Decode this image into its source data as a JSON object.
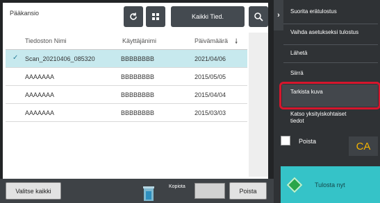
{
  "browser": {
    "folder_title": "Pääkansio",
    "filter_label": "Kaikki Tied.",
    "columns": {
      "file_name": "Tiedoston Nimi",
      "user_name": "Käyttäjänimi",
      "date": "Päivämäärä"
    },
    "rows": [
      {
        "name": "Scan_20210406_085320",
        "user": "BBBBBBBB",
        "date": "2021/04/06",
        "selected": true
      },
      {
        "name": "AAAAAAA",
        "user": "BBBBBBBB",
        "date": "2015/05/05",
        "selected": false
      },
      {
        "name": "AAAAAAA",
        "user": "BBBBBBBB",
        "date": "2015/04/04",
        "selected": false
      },
      {
        "name": "AAAAAAA",
        "user": "BBBBBBBB",
        "date": "2015/03/03",
        "selected": false
      }
    ]
  },
  "bottom_bar": {
    "select_all_label": "Valitse kaikki",
    "copies_label": "Kopiota",
    "delete_label": "Poista"
  },
  "menu": {
    "items": [
      "Suorita erätulostus",
      "Vaihda asetukseksi tulostus",
      "Lähetä",
      "Siirrä",
      "Tarkista kuva",
      "Katso yksityiskohtaiset tiedot"
    ],
    "delete_checkbox_label": "Poista",
    "ca_label": "CA",
    "print_now_label": "Tulosta nyt"
  },
  "colors": {
    "accent": "#35c3c8",
    "highlight": "#d6162d",
    "selected_row": "#c7e9ee",
    "ca": "#f5b400"
  }
}
